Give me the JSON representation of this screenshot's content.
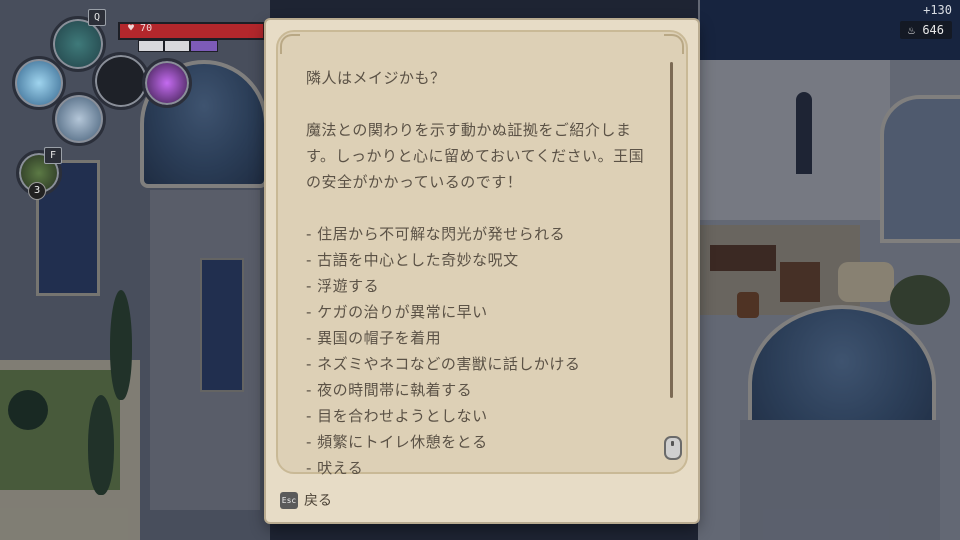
{
  "hud": {
    "hp": "70",
    "hp_fraction": 0.95,
    "skill_key": "Q",
    "item_key": "F",
    "item_count": "3",
    "mana_segments": 3
  },
  "currency": {
    "gain": "+130",
    "amount": "646"
  },
  "note": {
    "title": "隣人はメイジかも？",
    "intro": "魔法との関わりを示す動かぬ証拠をご紹介します。しっかりと心に留めておいてください。王国の安全がかかっているのです！",
    "items": [
      "- 住居から不可解な閃光が発せられる",
      "- 古語を中心とした奇妙な呪文",
      "- 浮遊する",
      "- ケガの治りが異常に早い",
      "- 異国の帽子を着用",
      "- ネズミやネコなどの害獣に話しかける",
      "- 夜の時間帯に執着する",
      "- 目を合わせようとしない",
      "- 頻繁にトイレ休憩をとる",
      "- 吠える"
    ]
  },
  "footer": {
    "esc_key": "Esc",
    "back_label": "戻る"
  },
  "colors": {
    "parchment": "#e7dcc6",
    "ink": "#5b5246",
    "hp_red": "#b3272c",
    "mana_purple": "#7d5bb8"
  }
}
